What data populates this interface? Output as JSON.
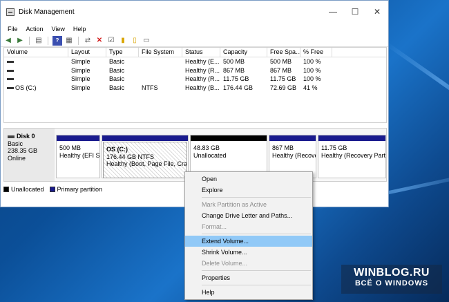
{
  "window": {
    "title": "Disk Management",
    "controls": [
      "—",
      "☐",
      "✕"
    ]
  },
  "menubar": [
    "File",
    "Action",
    "View",
    "Help"
  ],
  "volume_table": {
    "columns": [
      "Volume",
      "Layout",
      "Type",
      "File System",
      "Status",
      "Capacity",
      "Free Spa...",
      "% Free"
    ],
    "rows": [
      [
        "",
        "Simple",
        "Basic",
        "",
        "Healthy (E...",
        "500 MB",
        "500 MB",
        "100 %"
      ],
      [
        "",
        "Simple",
        "Basic",
        "",
        "Healthy (R...",
        "867 MB",
        "867 MB",
        "100 %"
      ],
      [
        "",
        "Simple",
        "Basic",
        "",
        "Healthy (R...",
        "11.75 GB",
        "11.75 GB",
        "100 %"
      ],
      [
        "OS (C:)",
        "Simple",
        "Basic",
        "NTFS",
        "Healthy (B...",
        "176.44 GB",
        "72.69 GB",
        "41 %"
      ]
    ]
  },
  "disk": {
    "name": "Disk 0",
    "type": "Basic",
    "size": "238.35 GB",
    "status": "Online"
  },
  "partitions": [
    {
      "name": "",
      "size": "500 MB",
      "status": "Healthy (EFI Sy"
    },
    {
      "name": "OS  (C:)",
      "size": "176.44 GB NTFS",
      "status": "Healthy (Boot, Page File, Crash"
    },
    {
      "name": "",
      "size": "48.83 GB",
      "status": "Unallocated"
    },
    {
      "name": "",
      "size": "867 MB",
      "status": "Healthy (Recove"
    },
    {
      "name": "",
      "size": "11.75 GB",
      "status": "Healthy (Recovery Partit"
    }
  ],
  "legend": {
    "unallocated": "Unallocated",
    "primary": "Primary partition"
  },
  "context_menu": {
    "open": "Open",
    "explore": "Explore",
    "mark_active": "Mark Partition as Active",
    "change_letter": "Change Drive Letter and Paths...",
    "format": "Format...",
    "extend": "Extend Volume...",
    "shrink": "Shrink Volume...",
    "delete": "Delete Volume...",
    "properties": "Properties",
    "help": "Help"
  },
  "watermark": {
    "line1": "WINBLOG.RU",
    "line2": "ВСЁ О WINDOWS"
  },
  "colors": {
    "primary_partition": "#1a1b8e",
    "unallocated": "#000000",
    "menu_highlight": "#91c9f7"
  }
}
